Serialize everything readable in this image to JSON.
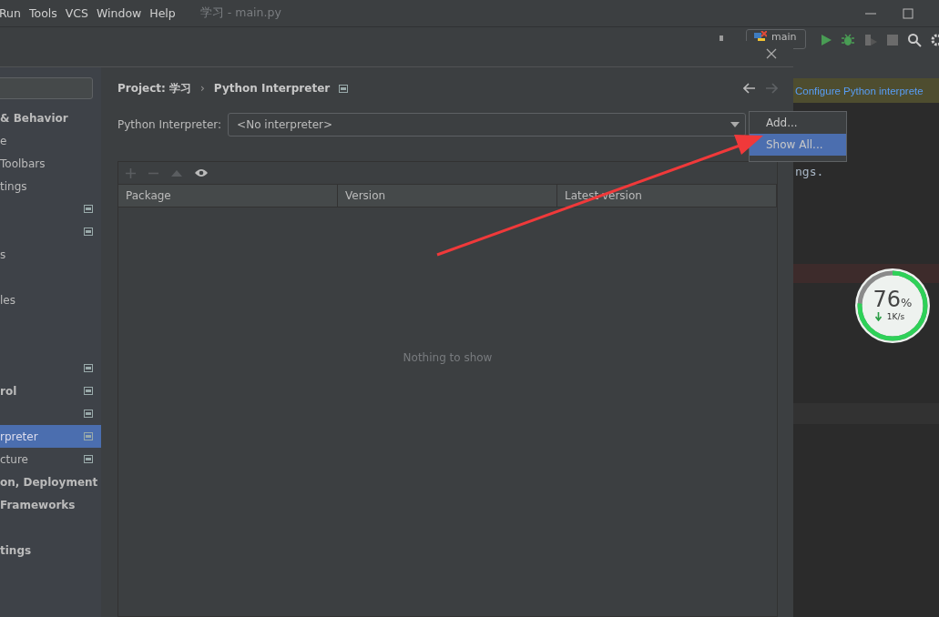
{
  "menu_bar": {
    "items": [
      "Run",
      "Tools",
      "VCS",
      "Window",
      "Help"
    ],
    "title": "学习 - main.py"
  },
  "toolbar": {
    "run_config": "main"
  },
  "editor": {
    "banner": "Configure Python interprete",
    "code_text": "ngs."
  },
  "dialog": {
    "sidebar": {
      "items": [
        {
          "kind": "item",
          "text": "& Behavior",
          "bold": true,
          "selected": false,
          "icon": false
        },
        {
          "kind": "item",
          "text": "e",
          "bold": false,
          "selected": false,
          "icon": false
        },
        {
          "kind": "item",
          "text": " Toolbars",
          "bold": false,
          "selected": false,
          "icon": false
        },
        {
          "kind": "item",
          "text": "tings",
          "bold": false,
          "selected": false,
          "icon": false
        },
        {
          "kind": "item",
          "selected": false,
          "icon": true
        },
        {
          "kind": "item",
          "selected": false,
          "icon": true
        },
        {
          "kind": "item",
          "text": "s",
          "bold": false,
          "selected": false,
          "icon": false
        },
        {
          "kind": "spacer"
        },
        {
          "kind": "item",
          "text": "les",
          "bold": false,
          "selected": false,
          "icon": false
        },
        {
          "kind": "spacer"
        },
        {
          "kind": "spacer"
        },
        {
          "kind": "item",
          "selected": false,
          "icon": true
        },
        {
          "kind": "item",
          "text": "rol",
          "bold": true,
          "selected": false,
          "icon": true
        },
        {
          "kind": "item",
          "selected": false,
          "icon": true
        },
        {
          "kind": "item",
          "text": "rpreter",
          "bold": false,
          "selected": true,
          "icon": true
        },
        {
          "kind": "item",
          "text": "cture",
          "bold": false,
          "selected": false,
          "icon": true
        },
        {
          "kind": "item",
          "text": "on, Deployment",
          "bold": true,
          "selected": false,
          "icon": false
        },
        {
          "kind": "item",
          "text": " Frameworks",
          "bold": true,
          "selected": false,
          "icon": false
        },
        {
          "kind": "spacer"
        },
        {
          "kind": "item",
          "text": "tings",
          "bold": true,
          "selected": false,
          "icon": false
        }
      ]
    },
    "breadcrumb": [
      "Project: 学习",
      "›",
      "Python Interpreter"
    ],
    "interpreter_label": "Python Interpreter:",
    "interpreter_value": "<No interpreter>",
    "table": {
      "columns": [
        "Package",
        "Version",
        "Latest version"
      ],
      "empty_text": "Nothing to show"
    },
    "popup": [
      {
        "label": "Add...",
        "selected": false
      },
      {
        "label": "Show All...",
        "selected": true
      }
    ]
  },
  "speed_widget": {
    "level": 0.76,
    "percent": "76",
    "unit": "%",
    "speed": "1K/s"
  }
}
